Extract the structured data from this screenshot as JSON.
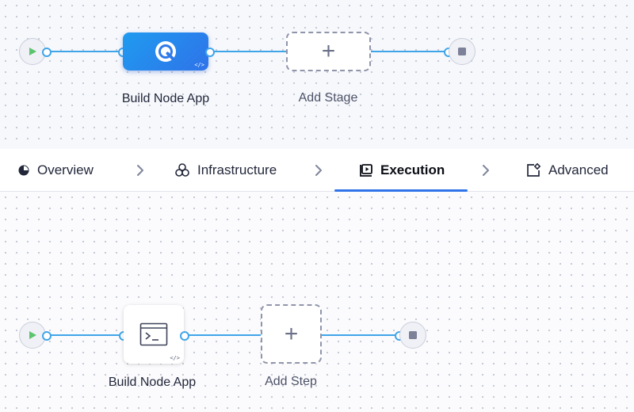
{
  "pipeline": {
    "stage": {
      "name": "Build Node App",
      "icon": "ci-stage-icon",
      "badge": "</>"
    },
    "add_stage": {
      "label": "Add Stage",
      "icon": "plus-icon",
      "symbol": "+"
    },
    "start_icon": "play-icon",
    "end_icon": "stop-icon"
  },
  "tabs": [
    {
      "label": "Overview",
      "icon": "overview-icon",
      "active": false
    },
    {
      "label": "Infrastructure",
      "icon": "infrastructure-icon",
      "active": false
    },
    {
      "label": "Execution",
      "icon": "execution-icon",
      "active": true
    },
    {
      "label": "Advanced",
      "icon": "advanced-icon",
      "active": false
    }
  ],
  "execution": {
    "step": {
      "name": "Build Node App",
      "icon": "terminal-icon",
      "badge": "</>"
    },
    "add_step": {
      "label": "Add Step",
      "icon": "plus-icon",
      "symbol": "+"
    },
    "start_icon": "play-icon",
    "end_icon": "stop-icon"
  },
  "colors": {
    "edge": "#3fa5e9",
    "stage_gradient_start": "#1f9bf0",
    "stage_gradient_end": "#2f73e9",
    "active_tab_underline": "#2f73e9",
    "play": "#5cc46e"
  }
}
